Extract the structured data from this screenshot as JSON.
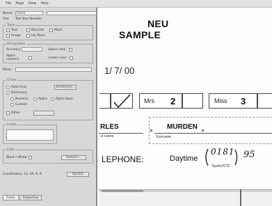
{
  "menubar": {
    "items": [
      "File",
      "Page",
      "View",
      "Help"
    ]
  },
  "panel": {
    "name_label": "Name:",
    "name_value": "Form1",
    "use_label": "Use:",
    "use_value": "Text Box Number",
    "group_type_title": "Type",
    "type_options": [
      "Text",
      "Barcode",
      "Mark",
      "Image",
      "Ink Paint"
    ],
    "group_recog_title": "Recognition",
    "recog_fields": [
      "Accuracy",
      "Upper case",
      "Alpha numeric",
      "Lower case"
    ],
    "mask_label": "Mask:",
    "group_check_title": "Check",
    "check_options": [
      "Valid Only",
      "Dictionary"
    ],
    "check_button": "Dictionary...",
    "sub_options": [
      "Numeric",
      "Alpha",
      "Alpha Num",
      "Custom"
    ],
    "other_label": "Other",
    "group_limit_title": "Limits",
    "group_ocr_title": "Color",
    "ocr_label": "Black / White",
    "ocr_button": "Options...",
    "coords_label": "Coordinates: 12, 44, 6, 9",
    "coords_button": "Update",
    "tabs": [
      "Fields",
      "Properties"
    ]
  },
  "document": {
    "title_line_1": "NEU",
    "title_line_2": "SAMPLE",
    "date": "1/ 7/ 00",
    "checkbox_rows": [
      {
        "label": "Mrs",
        "num": "2"
      },
      {
        "label": "Miss",
        "num": "3"
      }
    ],
    "first_name": "RLES",
    "first_name_caption": "st name",
    "surname": "MURDEN",
    "surname_caption": "Surname",
    "phone_label": "LEPHONE:",
    "daytime_label": "Daytime",
    "handwritten_code": "0181",
    "handwritten_code_2": "95",
    "handwritten_caption": "Spots/STD"
  },
  "colors": {
    "panel_bg": "#d8d8d8",
    "doc_bg": "#fdfdfd",
    "ink": "#111111"
  }
}
